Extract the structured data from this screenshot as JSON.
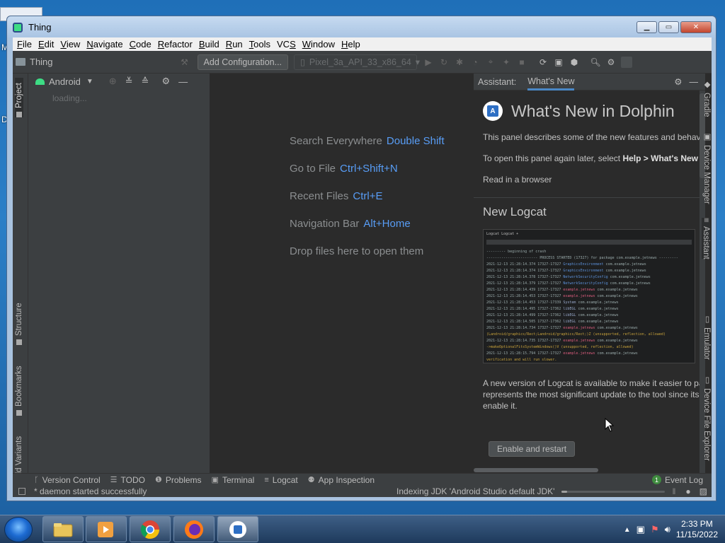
{
  "window": {
    "title": "Thing"
  },
  "menu": [
    "File",
    "Edit",
    "View",
    "Navigate",
    "Code",
    "Refactor",
    "Build",
    "Run",
    "Tools",
    "VCS",
    "Window",
    "Help"
  ],
  "menu_underline": [
    "F",
    "E",
    "V",
    "N",
    "C",
    "R",
    "B",
    "R",
    "T",
    "S",
    "W",
    "H"
  ],
  "toolbar": {
    "project_name": "Thing",
    "config_button": "Add Configuration...",
    "device": "Pixel_3a_API_33_x86_64"
  },
  "left_tabs": {
    "project": "Project",
    "structure": "Structure",
    "bookmarks": "Bookmarks",
    "build_variants": "Build Variants"
  },
  "project_panel": {
    "view_mode": "Android",
    "loading": "loading..."
  },
  "editor_hints": [
    {
      "label": "Search Everywhere",
      "shortcut": "Double Shift"
    },
    {
      "label": "Go to File",
      "shortcut": "Ctrl+Shift+N"
    },
    {
      "label": "Recent Files",
      "shortcut": "Ctrl+E"
    },
    {
      "label": "Navigation Bar",
      "shortcut": "Alt+Home"
    },
    {
      "label": "Drop files here to open them",
      "shortcut": ""
    }
  ],
  "assistant": {
    "header": "Assistant:",
    "tab": "What's New",
    "title": "What's New in Dolphin",
    "intro": "This panel describes some of the new features and behavio",
    "reopen_prefix": "To open this panel again later, select ",
    "reopen_menu": "Help > What's New i",
    "browser_link": "Read in a browser",
    "section_title": "New Logcat",
    "section_desc_1": "A new version of Logcat is available to make it easier to par",
    "section_desc_2": "represents the most significant update to the tool since its i",
    "section_desc_3": "enable it.",
    "enable_button": "Enable and restart"
  },
  "right_tabs": {
    "gradle": "Gradle",
    "device_manager": "Device Manager",
    "assistant": "Assistant",
    "emulator": "Emulator",
    "device_file_explorer": "Device File Explorer"
  },
  "bottom_tools": [
    "Version Control",
    "TODO",
    "Problems",
    "Terminal",
    "Logcat",
    "App Inspection"
  ],
  "event_log": {
    "count": "1",
    "label": "Event Log"
  },
  "status": {
    "message": "* daemon started successfully",
    "task": "Indexing JDK 'Android Studio default JDK'",
    "progress_fraction": 0.05
  },
  "taskbar": {
    "time": "2:33 PM",
    "date": "11/15/2022"
  },
  "colors": {
    "accent": "#589df6",
    "ide_bg": "#2b2b2b",
    "panel_bg": "#3c3f41",
    "event_green": "#3f8c3f"
  }
}
